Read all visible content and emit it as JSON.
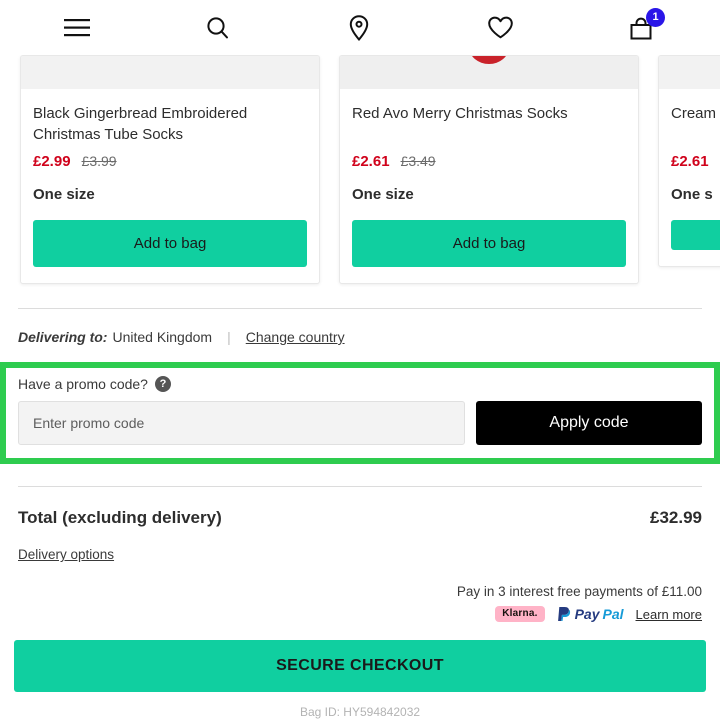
{
  "header": {
    "menu_icon": "hamburger-menu-icon",
    "search_icon": "search-icon",
    "location_icon": "location-pin-icon",
    "wishlist_icon": "heart-icon",
    "bag_icon": "shopping-bag-icon",
    "bag_count": "1"
  },
  "products": [
    {
      "title": "Black Gingerbread Embroidered Christmas Tube Socks",
      "price_now": "£2.99",
      "price_was": "£3.99",
      "size": "One size",
      "add_label": "Add to bag"
    },
    {
      "title": "Red Avo Merry Christmas Socks",
      "price_now": "£2.61",
      "price_was": "£3.49",
      "size": "One size",
      "add_label": "Add to bag"
    },
    {
      "title": "Cream",
      "price_now": "£2.61",
      "price_was": "",
      "size": "One s",
      "add_label": ""
    }
  ],
  "delivery": {
    "label": "Delivering to:",
    "country": "United Kingdom",
    "separator": "|",
    "change_link": "Change country"
  },
  "promo": {
    "label": "Have a promo code?",
    "help_glyph": "?",
    "placeholder": "Enter promo code",
    "value": "",
    "apply_label": "Apply code",
    "highlight_color": "#2ecc4f"
  },
  "totals": {
    "label": "Total (excluding delivery)",
    "value": "£32.99",
    "delivery_options_link": "Delivery options"
  },
  "paylater": {
    "text": "Pay in 3 interest free payments of £11.00",
    "klarna_label": "Klarna.",
    "paypal_pay": "Pay",
    "paypal_pal": "Pal",
    "learn_more": "Learn more"
  },
  "checkout": {
    "label": "SECURE CHECKOUT",
    "bag_id": "Bag ID: HY594842032",
    "accent_color": "#10cfa0"
  }
}
